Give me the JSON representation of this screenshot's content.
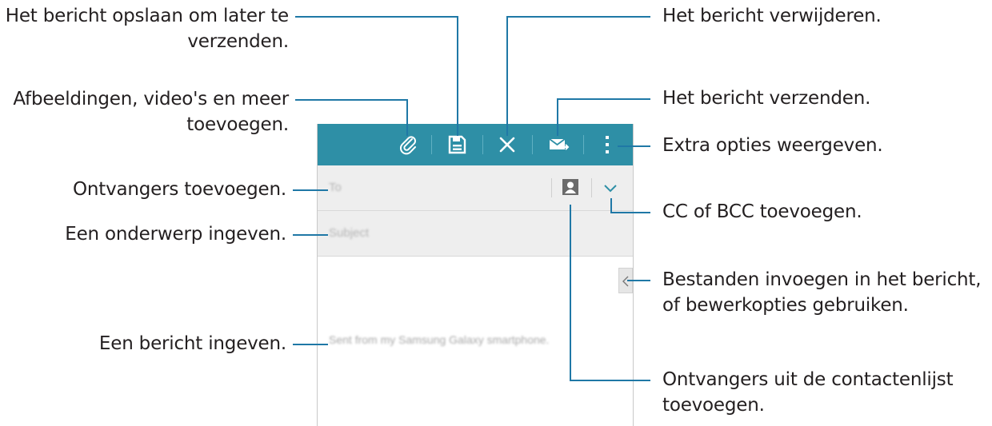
{
  "callouts": {
    "save": "Het bericht opslaan om later te verzenden.",
    "save_line1": "Het bericht opslaan om later te",
    "save_line2": "verzenden.",
    "attach_line1": "Afbeeldingen, video's en meer",
    "attach_line2": "toevoegen.",
    "recipients": "Ontvangers toevoegen.",
    "subject": "Een onderwerp ingeven.",
    "message": "Een bericht ingeven.",
    "delete": "Het bericht verwijderen.",
    "send": "Het bericht verzenden.",
    "more": "Extra opties weergeven.",
    "ccbcc": "CC of BCC toevoegen.",
    "insert_line1": "Bestanden invoegen in het bericht,",
    "insert_line2": "of bewerkopties gebruiken.",
    "contacts_line1": "Ontvangers uit de contactenlijst",
    "contacts_line2": "toevoegen."
  },
  "screen": {
    "to_placeholder": "To",
    "subject_placeholder": "Subject",
    "body_signature": "Sent from my Samsung Galaxy smartphone.",
    "toolbar_color": "#2e8fa6",
    "field_bg": "#eeeeee"
  },
  "toolbar_icons": [
    "paperclip-icon",
    "save-icon",
    "close-icon",
    "send-mail-icon",
    "more-vert-icon"
  ],
  "field_icons": [
    "contact-icon",
    "chevron-down-icon",
    "chevron-left-icon"
  ],
  "leader_color": "#1f78a6"
}
